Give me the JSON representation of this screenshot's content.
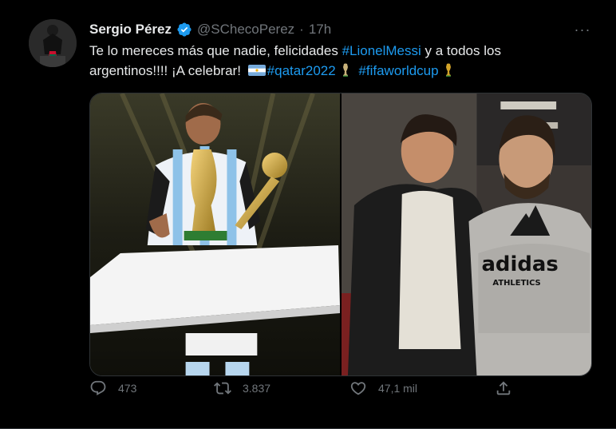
{
  "tweet": {
    "author_name": "Sergio Pérez",
    "handle": "@SChecoPerez",
    "separator": "·",
    "time": "17h",
    "more_label": "···",
    "text_part1": "Te lo mereces más que nadie, felicidades ",
    "hashtag1": "#LionelMessi",
    "text_part2": " y a todos los argentinos!!!! ¡A celebrar! ",
    "hashtag2": "#qatar2022",
    "hashtag3": "#fifaworldcup",
    "shirt_text": "adidas",
    "shirt_subtext": "ATHLETICS"
  },
  "actions": {
    "replies": "473",
    "retweets": "3.837",
    "likes": "47,1 mil"
  },
  "colors": {
    "background": "#000000",
    "text": "#e7e9ea",
    "secondary": "#71767b",
    "link": "#1d9bf0",
    "verified": "#1d9bf0"
  },
  "icons": [
    "verified-badge-icon",
    "more-icon",
    "argentina-flag-icon",
    "trophy-icon",
    "reply-icon",
    "retweet-icon",
    "like-icon",
    "share-icon"
  ]
}
